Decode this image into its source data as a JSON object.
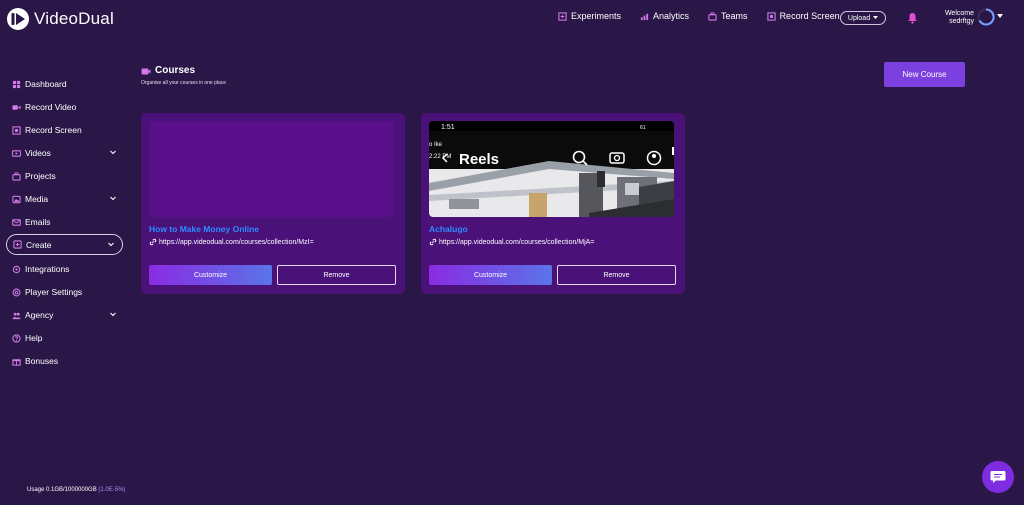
{
  "app": {
    "name": "VideoDual"
  },
  "topnav": {
    "items": [
      {
        "label": "Experiments",
        "icon": "experiments-icon"
      },
      {
        "label": "Analytics",
        "icon": "analytics-icon"
      },
      {
        "label": "Teams",
        "icon": "teams-icon"
      },
      {
        "label": "Record Screen",
        "icon": "record-screen-icon"
      }
    ],
    "upload_label": "Upload",
    "welcome_label": "Welcome",
    "username": "sedrftgy"
  },
  "sidebar": {
    "items": [
      {
        "label": "Dashboard",
        "icon": "dashboard-icon"
      },
      {
        "label": "Record Video",
        "icon": "video-camera-icon"
      },
      {
        "label": "Record Screen",
        "icon": "record-screen-icon"
      },
      {
        "label": "Videos",
        "icon": "videos-icon",
        "expandable": true
      },
      {
        "label": "Projects",
        "icon": "projects-icon"
      },
      {
        "label": "Media",
        "icon": "media-icon",
        "expandable": true
      },
      {
        "label": "Emails",
        "icon": "email-icon"
      },
      {
        "label": "Create",
        "icon": "create-icon",
        "expandable": true,
        "active": true
      },
      {
        "label": "Integrations",
        "icon": "integrations-icon"
      },
      {
        "label": "Player Settings",
        "icon": "player-settings-icon"
      },
      {
        "label": "Agency",
        "icon": "agency-icon",
        "expandable": true
      },
      {
        "label": "Help",
        "icon": "help-icon"
      },
      {
        "label": "Bonuses",
        "icon": "bonuses-icon"
      }
    ],
    "usage_label": "Usage 0.1GB/1000000GB",
    "usage_pct": "(1.0E-5%)"
  },
  "main": {
    "title": "Courses",
    "subtitle": "Organise all your courses in one place",
    "new_course_label": "New Course",
    "courses": [
      {
        "title": "How to Make Money Online",
        "link": "https://app.videodual.com/courses/collection/MzI=",
        "customize_label": "Customize",
        "remove_label": "Remove"
      },
      {
        "title": "Achalugo",
        "link": "https://app.videodual.com/courses/collection/MjA=",
        "customize_label": "Customize",
        "remove_label": "Remove",
        "thumbnail": {
          "time": "1:51",
          "battery": "61",
          "text1": "o Ike",
          "text2": "2:22 PM",
          "heading": "Reels"
        }
      }
    ]
  },
  "colors": {
    "background": "#2a1747",
    "card": "#4a1178",
    "accent": "#7c3fe0",
    "link_title": "#2f8cff"
  }
}
